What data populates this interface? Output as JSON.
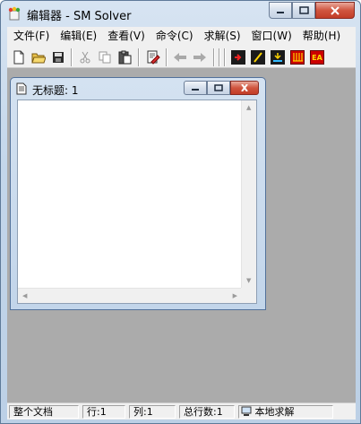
{
  "window": {
    "title": "编辑器 - SM Solver"
  },
  "menu": {
    "items": [
      {
        "label": "文件(F)"
      },
      {
        "label": "编辑(E)"
      },
      {
        "label": "查看(V)"
      },
      {
        "label": "命令(C)"
      },
      {
        "label": "求解(S)"
      },
      {
        "label": "窗口(W)"
      },
      {
        "label": "帮助(H)"
      }
    ]
  },
  "toolbar": {
    "buttons": [
      {
        "icon": "new-file-icon"
      },
      {
        "icon": "open-folder-icon"
      },
      {
        "icon": "save-icon"
      },
      {
        "icon": "cut-icon"
      },
      {
        "icon": "copy-icon"
      },
      {
        "icon": "paste-icon"
      },
      {
        "icon": "edit-document-icon"
      },
      {
        "icon": "back-arrow-icon"
      },
      {
        "icon": "forward-arrow-icon"
      },
      {
        "icon": "solve-tool-1-icon"
      },
      {
        "icon": "solve-tool-2-icon"
      },
      {
        "icon": "solve-tool-3-icon"
      },
      {
        "icon": "solve-tool-4-icon"
      },
      {
        "icon": "ea-tool-icon",
        "text": "EA"
      }
    ],
    "accent_red": "#cc0000",
    "accent_yellow": "#ffdd00"
  },
  "child_window": {
    "title": "无标题: 1"
  },
  "statusbar": {
    "scope": "整个文档",
    "row": "行:1",
    "col": "列:1",
    "total_rows": "总行数:1",
    "mode": "本地求解"
  }
}
